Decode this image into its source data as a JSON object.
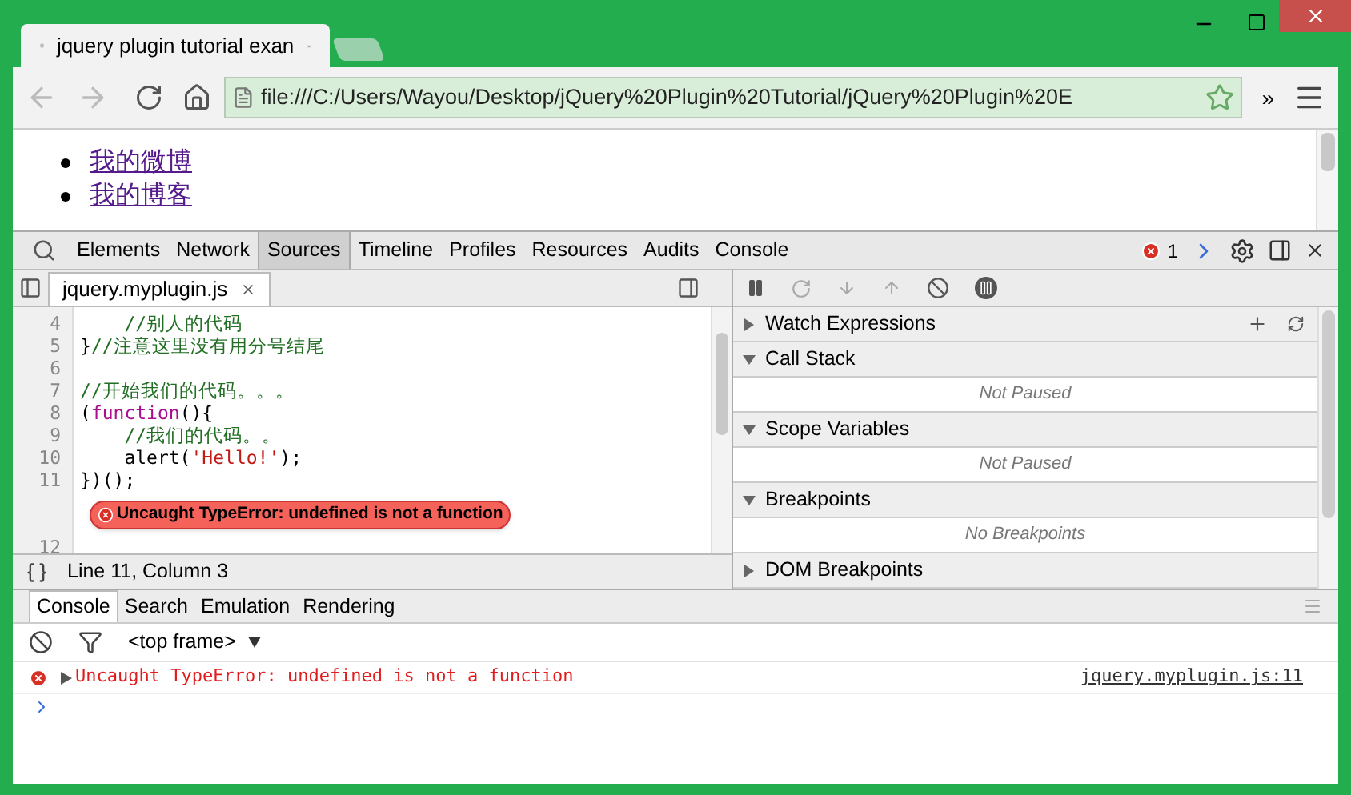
{
  "browser": {
    "tabs": [
      {
        "title": "jquery plugin tutorial exan",
        "selected": true
      }
    ],
    "url": "file:///C:/Users/Wayou/Desktop/jQuery%20Plugin%20Tutorial/jQuery%20Plugin%20E",
    "overflow": "»"
  },
  "page": {
    "links": [
      "我的微博",
      "我的博客"
    ]
  },
  "devtools": {
    "tabs": [
      {
        "label": "Elements",
        "selected": false
      },
      {
        "label": "Network",
        "selected": false
      },
      {
        "label": "Sources",
        "selected": true
      },
      {
        "label": "Timeline",
        "selected": false
      },
      {
        "label": "Profiles",
        "selected": false
      },
      {
        "label": "Resources",
        "selected": false
      },
      {
        "label": "Audits",
        "selected": false
      },
      {
        "label": "Console",
        "selected": false
      }
    ],
    "error_count": "1"
  },
  "sources": {
    "file_tab": "jquery.myplugin.js",
    "status": "Line 11, Column 3",
    "lines": [
      {
        "number": "4",
        "tokens": [
          {
            "kind": "comment",
            "text": "    //别人的代码"
          }
        ]
      },
      {
        "number": "5",
        "tokens": [
          {
            "kind": "plain",
            "text": "}"
          },
          {
            "kind": "comment",
            "text": "//注意这里没有用分号结尾"
          }
        ]
      },
      {
        "number": "6"
      },
      {
        "number": "7",
        "tokens": [
          {
            "kind": "comment",
            "text": "//开始我们的代码。。。"
          }
        ]
      },
      {
        "number": "8",
        "tokens": [
          {
            "kind": "plain",
            "text": "("
          },
          {
            "kind": "keyword",
            "text": "function"
          },
          {
            "kind": "plain",
            "text": "(){"
          }
        ]
      },
      {
        "number": "9",
        "tokens": [
          {
            "kind": "comment",
            "text": "    //我们的代码。。"
          }
        ]
      },
      {
        "number": "10",
        "tokens": [
          {
            "kind": "plain",
            "text": "    alert("
          },
          {
            "kind": "string",
            "text": "'Hello!'"
          },
          {
            "kind": "plain",
            "text": ");"
          }
        ]
      },
      {
        "number": "11",
        "tokens": [
          {
            "kind": "plain",
            "text": "})();"
          }
        ],
        "error": "Uncaught TypeError: undefined is not a function"
      },
      {
        "number": "12"
      }
    ]
  },
  "debugger": {
    "sections": [
      {
        "title": "Watch Expressions",
        "expanded": false
      },
      {
        "title": "Call Stack",
        "expanded": true,
        "empty_text": "Not Paused"
      },
      {
        "title": "Scope Variables",
        "expanded": true,
        "empty_text": "Not Paused"
      },
      {
        "title": "Breakpoints",
        "expanded": true,
        "empty_text": "No Breakpoints"
      },
      {
        "title": "DOM Breakpoints",
        "expanded": false
      }
    ]
  },
  "drawer": {
    "tabs": [
      {
        "label": "Console",
        "selected": true
      },
      {
        "label": "Search",
        "selected": false
      },
      {
        "label": "Emulation",
        "selected": false
      },
      {
        "label": "Rendering",
        "selected": false
      }
    ],
    "frame": "<top frame>",
    "messages": [
      {
        "kind": "error",
        "text": "Uncaught TypeError: undefined is not a function",
        "source": "jquery.myplugin.js:11"
      }
    ]
  }
}
